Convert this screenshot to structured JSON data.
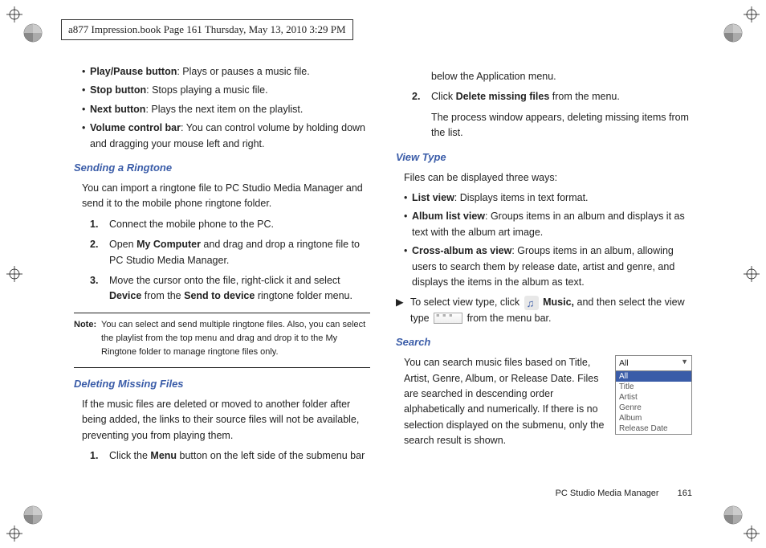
{
  "header": {
    "text": "a877 Impression.book  Page 161  Thursday, May 13, 2010  3:29 PM"
  },
  "left": {
    "bullets": [
      {
        "bold": "Play/Pause button",
        "rest": ": Plays or pauses a music file."
      },
      {
        "bold": "Stop button",
        "rest": ": Stops playing a music file."
      },
      {
        "bold": "Next button",
        "rest": ": Plays the next item on the playlist."
      },
      {
        "bold": "Volume control bar",
        "rest": ": You can control volume by holding down and dragging your mouse left and right."
      }
    ],
    "sending_head": "Sending a Ringtone",
    "sending_para": "You can import a ringtone file to PC Studio Media Manager and send it to the mobile phone ringtone folder.",
    "sending_steps": [
      {
        "n": "1.",
        "pre": "Connect the mobile phone to the PC."
      },
      {
        "n": "2.",
        "pre": "Open ",
        "b1": "My Computer",
        "post": " and drag and drop a ringtone file to PC Studio Media Manager."
      },
      {
        "n": "3.",
        "pre": "Move the cursor onto the file, right-click it and select ",
        "b1": "Device",
        "mid": " from the ",
        "b2": "Send to device",
        "post": " ringtone folder menu."
      }
    ],
    "note_label": "Note:",
    "note_text": "You can select and send multiple ringtone files. Also, you can select the playlist from the top menu and drag and drop it to the My Ringtone folder to manage ringtone files only.",
    "deleting_head": "Deleting Missing Files",
    "deleting_para": "If the music files are deleted or moved to another folder after being added, the links to their source files will not be available, preventing you from playing them.",
    "deleting_step1": {
      "n": "1.",
      "pre": "Click the ",
      "b1": "Menu",
      "post": " button on the left side of the submenu bar"
    }
  },
  "right": {
    "cont_para": "below the Application menu.",
    "del_step2": {
      "n": "2.",
      "pre": "Click ",
      "b1": "Delete missing files",
      "post": " from the menu."
    },
    "del_result": "The process window appears, deleting missing items from the list.",
    "viewtype_head": "View Type",
    "viewtype_intro": "Files can be displayed three ways:",
    "viewtype_bullets": [
      {
        "bold": "List view",
        "rest": ": Displays items in text format."
      },
      {
        "bold": "Album list view",
        "rest": ": Groups items in an album and displays it as text with the album art image."
      },
      {
        "bold": "Cross-album as view",
        "rest": ": Groups items in an album, allowing users to search them by release date, artist and genre, and displays the items in the album as text."
      }
    ],
    "viewtype_arrow_pre": "To select view type, click ",
    "viewtype_arrow_b": "Music,",
    "viewtype_arrow_mid": " and then select the view type ",
    "viewtype_arrow_post": " from the menu bar.",
    "search_head": "Search",
    "search_para": "You can search music files based on Title, Artist, Genre, Album, or Release Date. Files are searched in descending order alphabetically and numerically. If there is no selection displayed on the submenu, only the search result is shown.",
    "search_box": {
      "selected": "All",
      "options": [
        "All",
        "Title",
        "Artist",
        "Genre",
        "Album",
        "Release Date"
      ]
    }
  },
  "footer": {
    "section": "PC Studio Media Manager",
    "page": "161"
  }
}
